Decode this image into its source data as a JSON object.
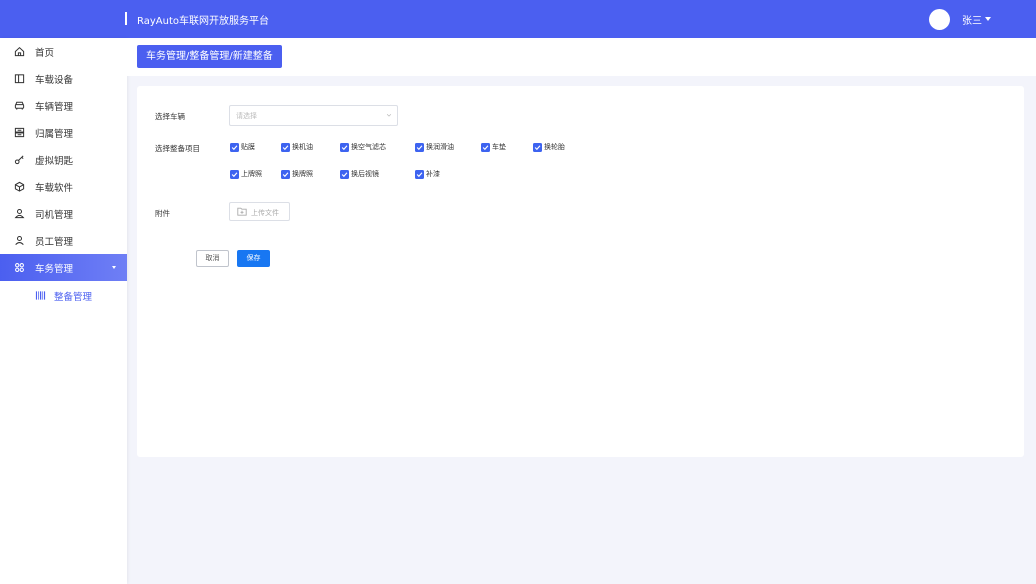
{
  "app": {
    "title": "RayAuto车联网开放服务平台",
    "user_name": "张三"
  },
  "colors": {
    "primary": "#4b5ff0",
    "checkbox": "#3d63f0",
    "save_button": "#1877f2"
  },
  "sidebar": {
    "items": [
      {
        "label": "首页",
        "icon": "home-icon"
      },
      {
        "label": "车载设备",
        "icon": "device-icon"
      },
      {
        "label": "车辆管理",
        "icon": "car-icon"
      },
      {
        "label": "归属管理",
        "icon": "ownership-icon"
      },
      {
        "label": "虚拟钥匙",
        "icon": "key-icon"
      },
      {
        "label": "车载软件",
        "icon": "software-icon"
      },
      {
        "label": "司机管理",
        "icon": "driver-icon"
      },
      {
        "label": "员工管理",
        "icon": "staff-icon"
      },
      {
        "label": "车务管理",
        "icon": "service-icon",
        "active": true,
        "expanded": true
      }
    ],
    "sub_items": [
      {
        "label": "整备管理",
        "icon": "barcode-icon",
        "active": true
      }
    ]
  },
  "breadcrumb": "车务管理/整备管理/新建整备",
  "form": {
    "vehicle_label": "选择车辆",
    "vehicle_placeholder": "请选择",
    "items_label": "选择整备项目",
    "items": [
      {
        "label": "贴膜",
        "checked": true
      },
      {
        "label": "换机油",
        "checked": true
      },
      {
        "label": "换空气滤芯",
        "checked": true
      },
      {
        "label": "换润滑油",
        "checked": true
      },
      {
        "label": "车垫",
        "checked": true
      },
      {
        "label": "换轮胎",
        "checked": true
      },
      {
        "label": "上牌照",
        "checked": true
      },
      {
        "label": "换牌照",
        "checked": true
      },
      {
        "label": "换后视镜",
        "checked": true
      },
      {
        "label": "补漆",
        "checked": true
      }
    ],
    "attachment_label": "附件",
    "upload_label": "上传文件",
    "cancel_label": "取消",
    "save_label": "保存"
  }
}
